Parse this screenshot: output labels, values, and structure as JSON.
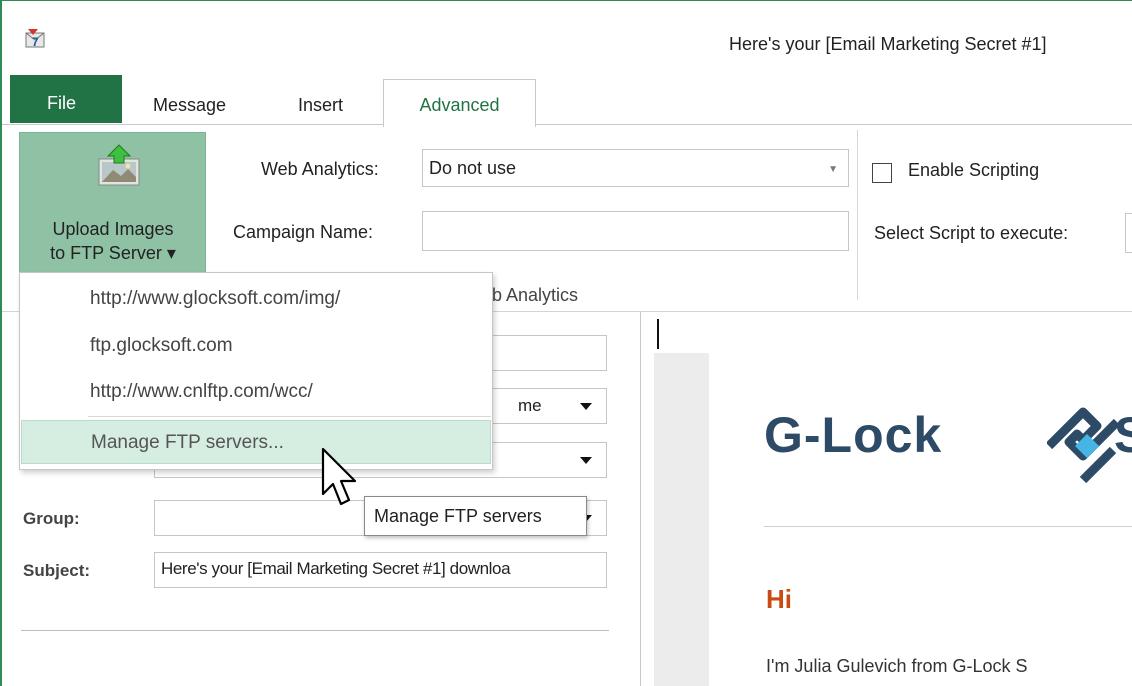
{
  "window": {
    "title": "Here's your [Email Marketing Secret #1]"
  },
  "ribbon_tabs": {
    "file": "File",
    "message": "Message",
    "insert": "Insert",
    "advanced": "Advanced"
  },
  "ribbon": {
    "upload_button_line1": "Upload Images",
    "upload_button_line2": "to FTP Server ▾",
    "web_analytics_label": "Web Analytics:",
    "web_analytics_value": "Do not use",
    "campaign_name_label": "Campaign Name:",
    "campaign_name_value": "",
    "group_caption": "b Analytics",
    "enable_scripting_label": "Enable Scripting",
    "select_script_label": "Select Script to execute:"
  },
  "ftp_menu": {
    "items": [
      "http://www.glocksoft.com/img/",
      "ftp.glocksoft.com",
      "http://www.cnlftp.com/wcc/"
    ],
    "manage": "Manage FTP servers..."
  },
  "tooltip": "Manage FTP servers",
  "form": {
    "partial_dropdown_text": "me",
    "group_label": "Group:",
    "group_value": "",
    "subject_label": "Subject:",
    "subject_value": "Here's your [Email Marketing Secret #1] downloa"
  },
  "editor": {
    "logo_text": "G-Lock",
    "logo_s": "S",
    "greeting_heading": "Hi",
    "body_line": "I'm Julia Gulevich from G-Lock S"
  },
  "colors": {
    "accent": "#217346",
    "upload_button": "#8fc1a4",
    "menu_hover": "#d6ede1",
    "logo": "#2d4a66",
    "hi_heading": "#c94a12"
  },
  "icons": [
    "app-icon",
    "upload-images-icon",
    "chevron-down-icon",
    "mouse-cursor-icon",
    "g-lock-logo-icon"
  ]
}
